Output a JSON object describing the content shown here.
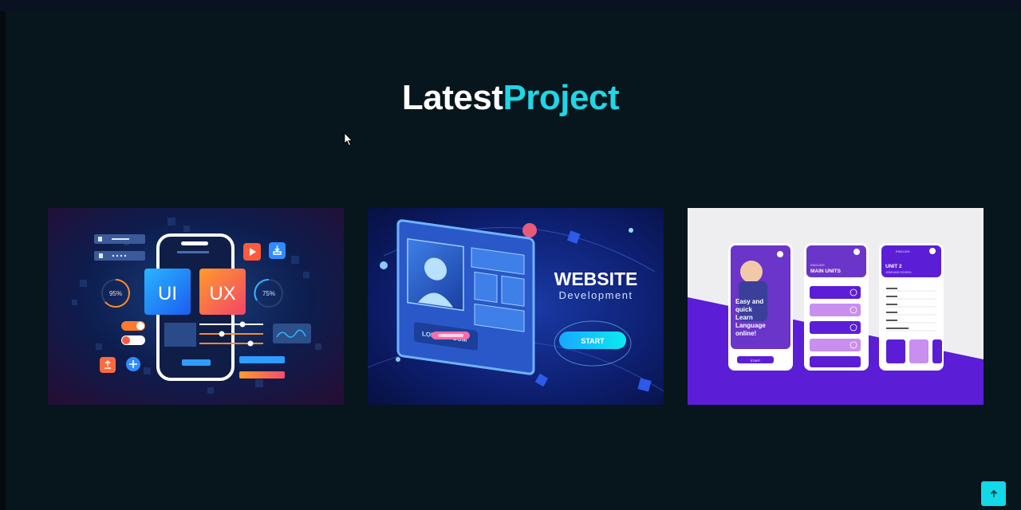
{
  "header": {
    "title_part1": "Latest",
    "title_part2": "Project"
  },
  "projects": [
    {
      "badge_left": "UI",
      "badge_right": "UX",
      "gauge_left": "95%",
      "gauge_right": "75%"
    },
    {
      "headline": "WEBSITE",
      "subline": "Development",
      "button": "START",
      "tag": "LOREM IPSUM"
    },
    {
      "tagline": [
        "Easy and",
        "quick",
        "Learn",
        "Language",
        "online!"
      ],
      "screen2_title": [
        "ENGLISH",
        "MAIN UNITS"
      ],
      "screen3_title": [
        "UNIT 2",
        "JOBS AND SCHOOL"
      ],
      "screen3_header": "ENGLISH",
      "start_button": "START"
    }
  ],
  "colors": {
    "background": "#07151c",
    "accent": "#1fd6e6",
    "purple": "#5b1ed6"
  },
  "back_to_top": {
    "icon": "arrow-up-icon"
  }
}
